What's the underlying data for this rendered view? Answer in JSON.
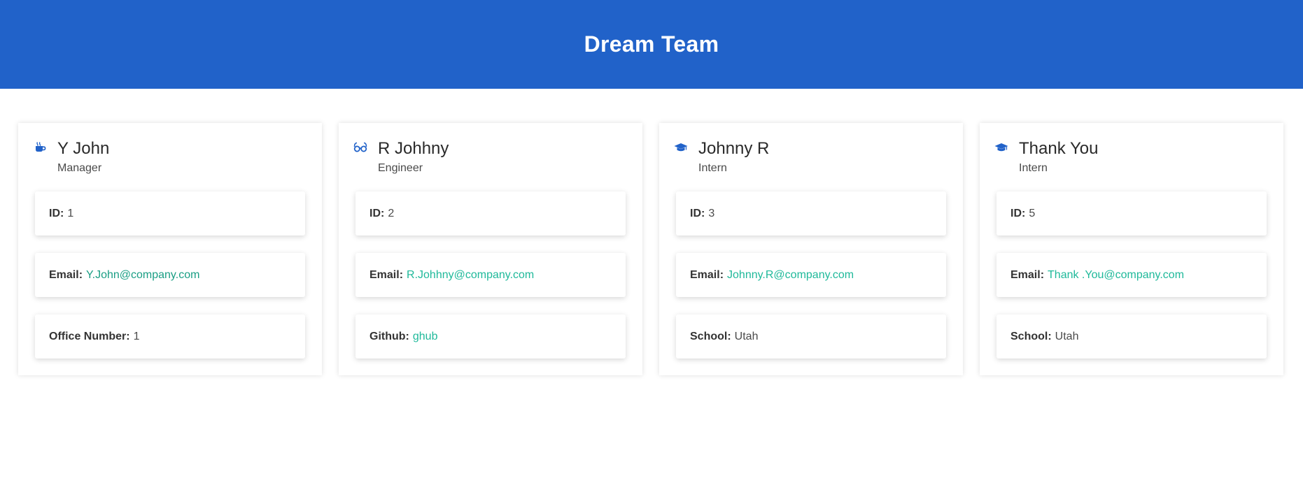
{
  "header": {
    "title": "Dream Team"
  },
  "colors": {
    "header_bg": "#2162c9",
    "icon": "#2162c9",
    "link": "#1fb99a"
  },
  "employees": [
    {
      "name": "Y John",
      "role": "Manager",
      "icon": "coffee-icon",
      "fields": [
        {
          "label": "ID:",
          "value": "1"
        },
        {
          "label": "Email:",
          "value": "Y.John@company.com"
        },
        {
          "label": "Office Number:",
          "value": "1"
        }
      ]
    },
    {
      "name": "R Johhny",
      "role": "Engineer",
      "icon": "glasses-icon",
      "fields": [
        {
          "label": "ID:",
          "value": "2"
        },
        {
          "label": "Email:",
          "value": "R.Johhny@company.com"
        },
        {
          "label": "Github:",
          "value": "ghub"
        }
      ]
    },
    {
      "name": "Johnny R",
      "role": "Intern",
      "icon": "graduation-cap-icon",
      "fields": [
        {
          "label": "ID:",
          "value": "3"
        },
        {
          "label": "Email:",
          "value": "Johnny.R@company.com"
        },
        {
          "label": "School:",
          "value": "Utah"
        }
      ]
    },
    {
      "name": "Thank You",
      "role": "Intern",
      "icon": "graduation-cap-icon",
      "fields": [
        {
          "label": "ID:",
          "value": "5"
        },
        {
          "label": "Email:",
          "value": "Thank .You@company.com"
        },
        {
          "label": "School:",
          "value": "Utah"
        }
      ]
    }
  ]
}
